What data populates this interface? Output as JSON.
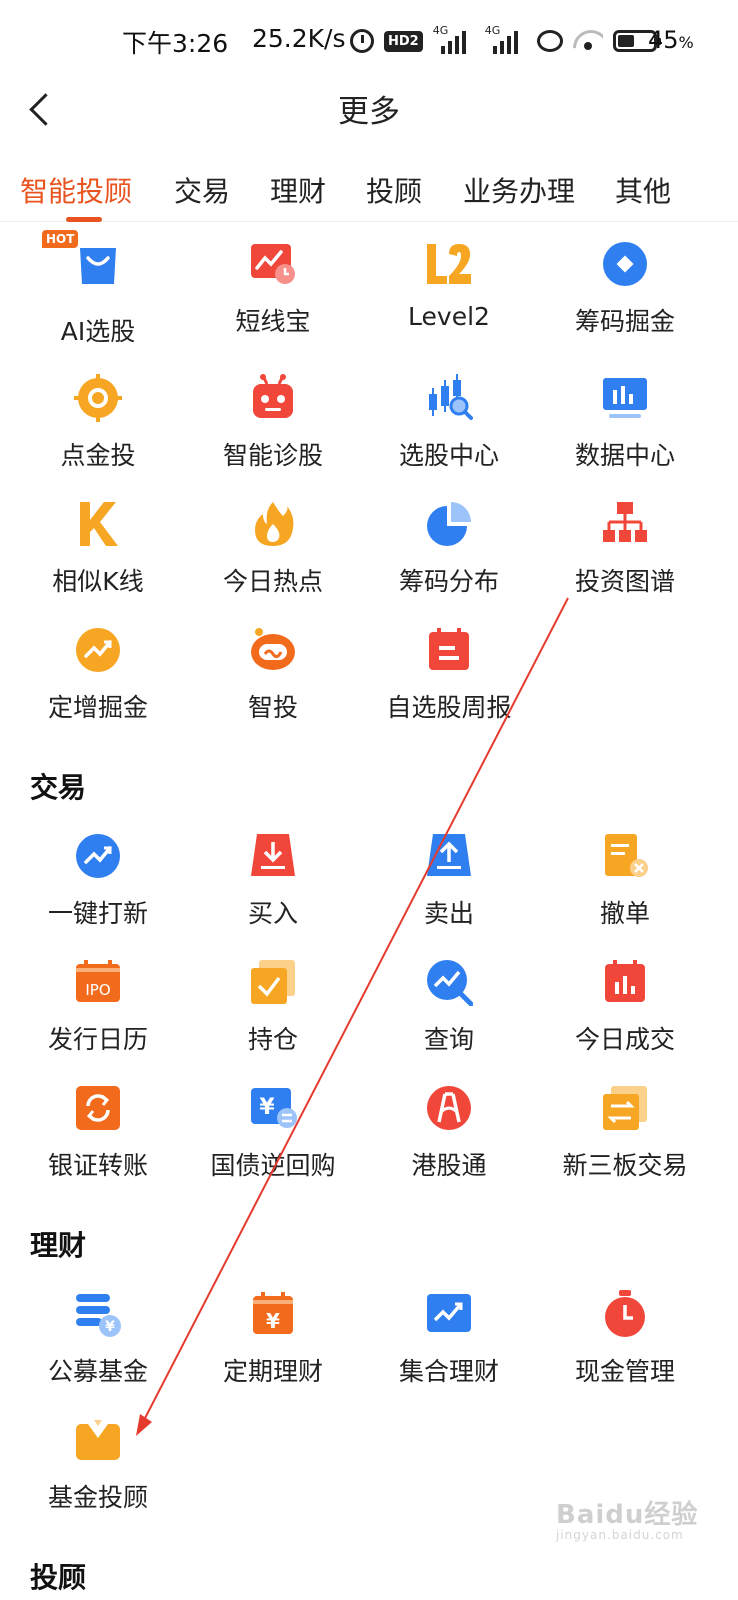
{
  "status": {
    "time": "下午3:26",
    "speed": "25.2K/s",
    "hd": "HD2",
    "net1": "4G",
    "net2": "4G",
    "battery": "45",
    "battery_unit": "%"
  },
  "header": {
    "title": "更多"
  },
  "tabs": [
    "智能投顾",
    "交易",
    "理财",
    "投顾",
    "业务办理",
    "其他"
  ],
  "sections": {
    "trade": "交易",
    "finance": "理财",
    "advisor_cut": "投顾"
  },
  "smart": [
    {
      "label": "AI选股",
      "icon": "shopping-bag-icon",
      "badge": "HOT"
    },
    {
      "label": "短线宝",
      "icon": "chart-clock-icon"
    },
    {
      "label": "Level2",
      "icon": "l2-icon"
    },
    {
      "label": "筹码掘金",
      "icon": "diamond-icon"
    },
    {
      "label": "点金投",
      "icon": "target-icon"
    },
    {
      "label": "智能诊股",
      "icon": "robot-icon"
    },
    {
      "label": "选股中心",
      "icon": "candlestick-search-icon"
    },
    {
      "label": "数据中心",
      "icon": "monitor-chart-icon"
    },
    {
      "label": "相似K线",
      "icon": "k-letter-icon"
    },
    {
      "label": "今日热点",
      "icon": "flame-icon"
    },
    {
      "label": "筹码分布",
      "icon": "pie-chart-icon"
    },
    {
      "label": "投资图谱",
      "icon": "org-chart-icon"
    },
    {
      "label": "定增掘金",
      "icon": "trend-circle-icon"
    },
    {
      "label": "智投",
      "icon": "robot-face-icon"
    },
    {
      "label": "自选股周报",
      "icon": "calendar-icon"
    }
  ],
  "trade": [
    {
      "label": "一键打新",
      "icon": "trend-circle-icon"
    },
    {
      "label": "买入",
      "icon": "download-tray-icon"
    },
    {
      "label": "卖出",
      "icon": "upload-tray-icon"
    },
    {
      "label": "撤单",
      "icon": "document-cancel-icon"
    },
    {
      "label": "发行日历",
      "icon": "ipo-calendar-icon",
      "text": "IPO"
    },
    {
      "label": "持仓",
      "icon": "checkbox-stack-icon"
    },
    {
      "label": "查询",
      "icon": "search-trend-icon"
    },
    {
      "label": "今日成交",
      "icon": "calendar-bars-icon"
    },
    {
      "label": "银证转账",
      "icon": "refresh-icon"
    },
    {
      "label": "国债逆回购",
      "icon": "yen-exchange-icon",
      "text": "¥"
    },
    {
      "label": "港股通",
      "icon": "bridge-icon"
    },
    {
      "label": "新三板交易",
      "icon": "transfer-doc-icon"
    }
  ],
  "finance": [
    {
      "label": "公募基金",
      "icon": "coin-stack-icon",
      "text": "¥"
    },
    {
      "label": "定期理财",
      "icon": "yen-calendar-icon",
      "text": "¥"
    },
    {
      "label": "集合理财",
      "icon": "trend-board-icon"
    },
    {
      "label": "现金管理",
      "icon": "stopwatch-icon"
    },
    {
      "label": "基金投顾",
      "icon": "suit-briefcase-icon"
    }
  ],
  "watermark": {
    "brand": "Bai",
    "brand2": "du",
    "suffix": "经验",
    "domain": "jingyan.baidu.com"
  },
  "colors": {
    "accent": "#e8531f",
    "blue": "#2f7ff0",
    "orange": "#f7a623",
    "red": "#f0473a"
  }
}
